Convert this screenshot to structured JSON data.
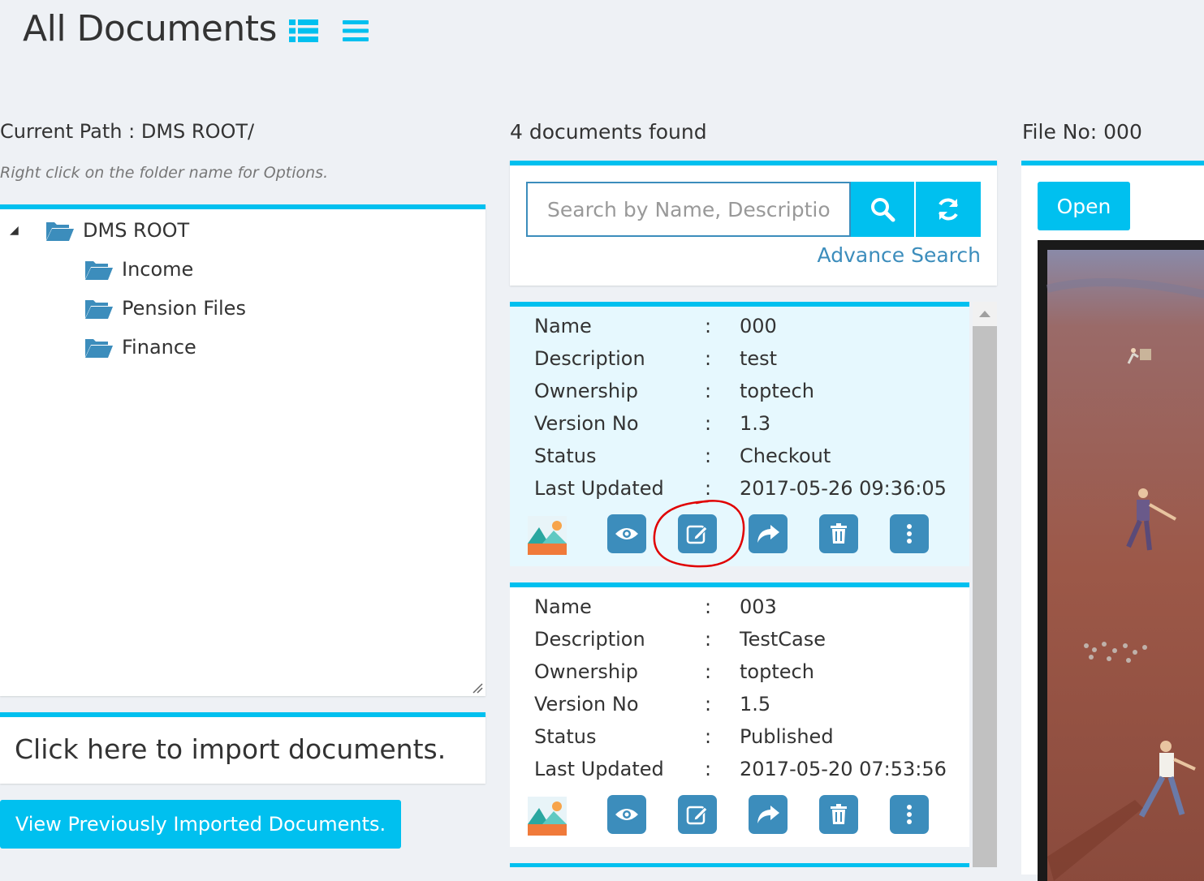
{
  "header": {
    "title": "All Documents",
    "icons": [
      "list-view-icon",
      "compact-list-icon"
    ]
  },
  "left": {
    "current_path_label": "Current Path : DMS ROOT/",
    "hint": "Right click on the folder name for Options.",
    "tree": {
      "root": "DMS ROOT",
      "children": [
        "Income",
        "Pension Files",
        "Finance"
      ]
    },
    "import_text": "Click here to import documents.",
    "view_previous_label": "View Previously Imported Documents."
  },
  "middle": {
    "count_text": "4 documents found",
    "search": {
      "placeholder": "Search by Name, Description",
      "advance_label": "Advance Search"
    },
    "field_labels": [
      "Name",
      "Description",
      "Ownership",
      "Version No",
      "Status",
      "Last Updated"
    ],
    "separator": ":",
    "documents": [
      {
        "name": "000",
        "description": "test",
        "ownership": "toptech",
        "version": "1.3",
        "status": "Checkout",
        "last_updated": "2017-05-26 09:36:05"
      },
      {
        "name": "003",
        "description": "TestCase",
        "ownership": "toptech",
        "version": "1.5",
        "status": "Published",
        "last_updated": "2017-05-20 07:53:56"
      }
    ],
    "actions": [
      "view-icon",
      "edit-icon",
      "share-icon",
      "delete-icon",
      "more-icon"
    ]
  },
  "right": {
    "file_no_label": "File No: 000",
    "open_label": "Open"
  },
  "colors": {
    "accent": "#00c0ef",
    "primary": "#3c8dbc",
    "background": "#eef1f5",
    "active_card": "#e6f8fe",
    "annotation": "#e00000"
  }
}
